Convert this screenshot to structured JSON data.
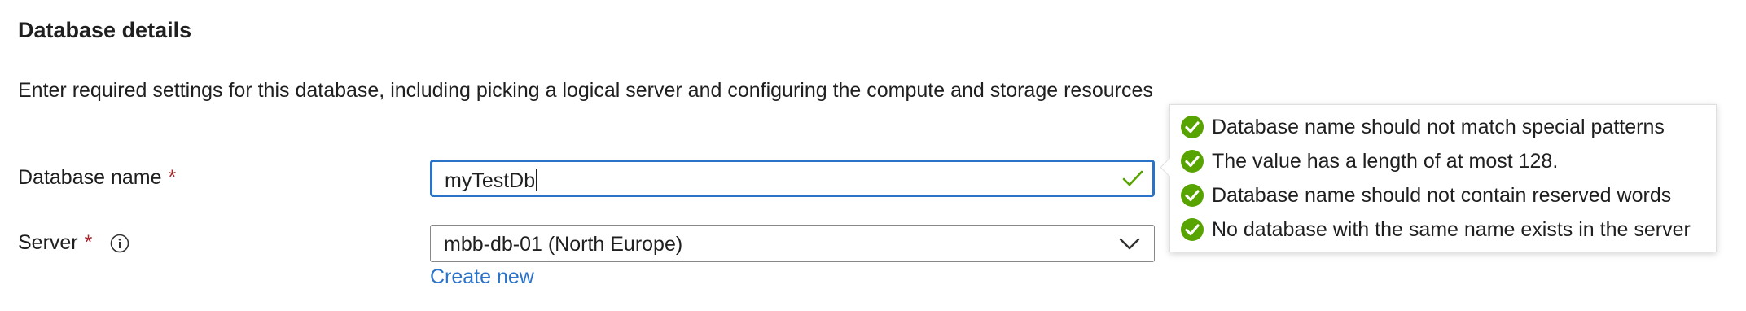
{
  "section": {
    "title": "Database details"
  },
  "description": "Enter required settings for this database, including picking a logical server and configuring the compute and storage resources",
  "database_name": {
    "label": "Database name",
    "required_marker": "*",
    "value": "myTestDb",
    "valid_icon": "checkmark-icon"
  },
  "server": {
    "label": "Server",
    "required_marker": "*",
    "info_icon": "info-icon",
    "selected": "mbb-db-01 (North Europe)",
    "dropdown_icon": "chevron-down-icon",
    "create_new_label": "Create new"
  },
  "validation": {
    "status_icon": "success-check-circle-icon",
    "rules": [
      {
        "text": "Database name should not match special patterns",
        "status": "passed"
      },
      {
        "text": "The value has a length of at most 128.",
        "status": "passed"
      },
      {
        "text": "Database name should not contain reserved words",
        "status": "passed"
      },
      {
        "text": "No database with the same name exists in the server",
        "status": "passed"
      }
    ]
  },
  "colors": {
    "accent": "#2b73c8",
    "required": "#a4262c",
    "success": "#57a300",
    "text": "#1f1f1f",
    "border": "#8a8886"
  }
}
